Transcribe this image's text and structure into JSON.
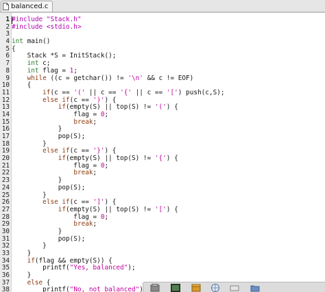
{
  "tab": {
    "title": "balanced.c"
  },
  "lines": [
    [
      {
        "t": "#include \"Stack.h\"",
        "c": "pp"
      }
    ],
    [
      {
        "t": "#include <stdio.h>",
        "c": "pp"
      }
    ],
    [],
    [
      {
        "t": "int",
        "c": "ty"
      },
      {
        "t": " main()"
      }
    ],
    [
      {
        "t": "{"
      }
    ],
    [
      {
        "t": "    Stack *S = InitStack();"
      }
    ],
    [
      {
        "t": "    "
      },
      {
        "t": "int",
        "c": "ty"
      },
      {
        "t": " c;"
      }
    ],
    [
      {
        "t": "    "
      },
      {
        "t": "int",
        "c": "ty"
      },
      {
        "t": " flag = "
      },
      {
        "t": "1",
        "c": "num"
      },
      {
        "t": ";"
      }
    ],
    [
      {
        "t": "    "
      },
      {
        "t": "while",
        "c": "kw"
      },
      {
        "t": " ((c = getchar()) != "
      },
      {
        "t": "'\\n'",
        "c": "str"
      },
      {
        "t": " && c != EOF)"
      }
    ],
    [
      {
        "t": "    {"
      }
    ],
    [
      {
        "t": "        "
      },
      {
        "t": "if",
        "c": "kw"
      },
      {
        "t": "(c == "
      },
      {
        "t": "'('",
        "c": "str"
      },
      {
        "t": " || c == "
      },
      {
        "t": "'{'",
        "c": "str"
      },
      {
        "t": " || c == "
      },
      {
        "t": "'['",
        "c": "str"
      },
      {
        "t": ") push(c,S);"
      }
    ],
    [
      {
        "t": "        "
      },
      {
        "t": "else if",
        "c": "kw"
      },
      {
        "t": "(c == "
      },
      {
        "t": "')'",
        "c": "str"
      },
      {
        "t": ") {"
      }
    ],
    [
      {
        "t": "            "
      },
      {
        "t": "if",
        "c": "kw"
      },
      {
        "t": "(empty(S) || top(S) != "
      },
      {
        "t": "'('",
        "c": "str"
      },
      {
        "t": ") {"
      }
    ],
    [
      {
        "t": "                flag = "
      },
      {
        "t": "0",
        "c": "num"
      },
      {
        "t": ";"
      }
    ],
    [
      {
        "t": "                "
      },
      {
        "t": "break",
        "c": "kw"
      },
      {
        "t": ";"
      }
    ],
    [
      {
        "t": "            }"
      }
    ],
    [
      {
        "t": "            pop(S);"
      }
    ],
    [
      {
        "t": "        }"
      }
    ],
    [
      {
        "t": "        "
      },
      {
        "t": "else if",
        "c": "kw"
      },
      {
        "t": "(c == "
      },
      {
        "t": "'}'",
        "c": "str"
      },
      {
        "t": ") {"
      }
    ],
    [
      {
        "t": "            "
      },
      {
        "t": "if",
        "c": "kw"
      },
      {
        "t": "(empty(S) || top(S) != "
      },
      {
        "t": "'{'",
        "c": "str"
      },
      {
        "t": ") {"
      }
    ],
    [
      {
        "t": "                flag = "
      },
      {
        "t": "0",
        "c": "num"
      },
      {
        "t": ";"
      }
    ],
    [
      {
        "t": "                "
      },
      {
        "t": "break",
        "c": "kw"
      },
      {
        "t": ";"
      }
    ],
    [
      {
        "t": "            }"
      }
    ],
    [
      {
        "t": "            pop(S);"
      }
    ],
    [
      {
        "t": "        }"
      }
    ],
    [
      {
        "t": "        "
      },
      {
        "t": "else if",
        "c": "kw"
      },
      {
        "t": "(c == "
      },
      {
        "t": "']'",
        "c": "str"
      },
      {
        "t": ") {"
      }
    ],
    [
      {
        "t": "            "
      },
      {
        "t": "if",
        "c": "kw"
      },
      {
        "t": "(empty(S) || top(S) != "
      },
      {
        "t": "'['",
        "c": "str"
      },
      {
        "t": ") {"
      }
    ],
    [
      {
        "t": "                flag = "
      },
      {
        "t": "0",
        "c": "num"
      },
      {
        "t": ";"
      }
    ],
    [
      {
        "t": "                "
      },
      {
        "t": "break",
        "c": "kw"
      },
      {
        "t": ";"
      }
    ],
    [
      {
        "t": "            }"
      }
    ],
    [
      {
        "t": "            pop(S);"
      }
    ],
    [
      {
        "t": "        }"
      }
    ],
    [
      {
        "t": "    }"
      }
    ],
    [
      {
        "t": "    "
      },
      {
        "t": "if",
        "c": "kw"
      },
      {
        "t": "(flag && empty(S)) {"
      }
    ],
    [
      {
        "t": "        printf("
      },
      {
        "t": "\"Yes, balanced\"",
        "c": "str"
      },
      {
        "t": ");"
      }
    ],
    [
      {
        "t": "    }"
      }
    ],
    [
      {
        "t": "    "
      },
      {
        "t": "else",
        "c": "kw"
      },
      {
        "t": " {"
      }
    ],
    [
      {
        "t": "        printf("
      },
      {
        "t": "\"No, not balanced\"",
        "c": "str"
      },
      {
        "t": ");"
      }
    ],
    [
      {
        "t": "    }"
      }
    ]
  ],
  "current_line": 1,
  "taskbar": {
    "icons": [
      "files-icon",
      "image-viewer-icon",
      "package-icon",
      "browser-icon",
      "folder-icon"
    ]
  }
}
